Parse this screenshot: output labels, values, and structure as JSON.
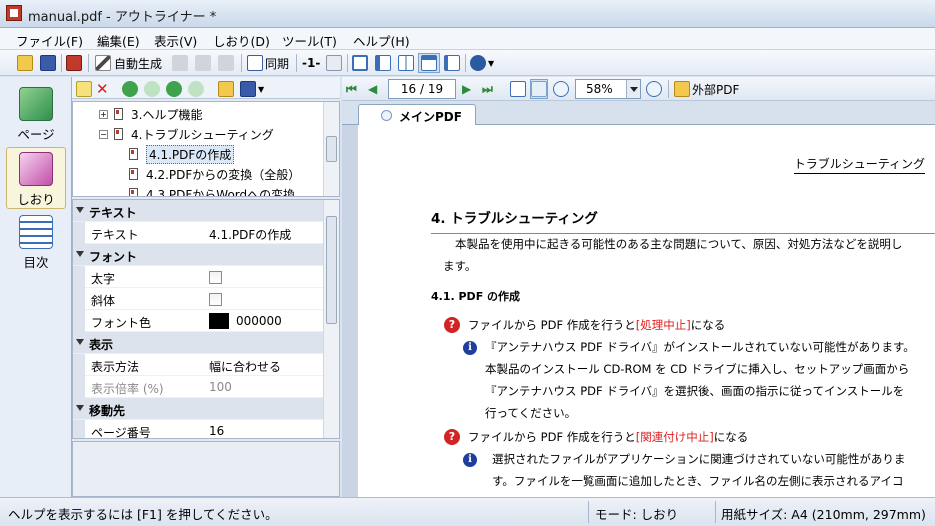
{
  "window": {
    "title": "manual.pdf - アウトライナー *"
  },
  "menu": [
    "ファイル(F)",
    "編集(E)",
    "表示(V)",
    "しおり(D)",
    "ツール(T)",
    "ヘルプ(H)"
  ],
  "toolbar": {
    "auto_generate": "自動生成",
    "sync": "同期",
    "one": "-1-"
  },
  "leftnav": [
    {
      "label": "ページ"
    },
    {
      "label": "しおり"
    },
    {
      "label": "目次"
    }
  ],
  "tree": {
    "items": [
      {
        "label": "3.ヘルプ機能",
        "expander": "+"
      },
      {
        "label": "4.トラブルシューティング",
        "expander": "−"
      },
      {
        "label": "4.1.PDFの作成"
      },
      {
        "label": "4.2.PDFからの変換（全般）"
      },
      {
        "label": "4.3.PDFからWordへの変換"
      }
    ]
  },
  "props": {
    "cat_text": "テキスト",
    "text_key": "テキスト",
    "text_val": "4.1.PDFの作成",
    "cat_font": "フォント",
    "bold_key": "太字",
    "italic_key": "斜体",
    "color_key": "フォント色",
    "color_val": "000000",
    "cat_display": "表示",
    "method_key": "表示方法",
    "method_val": "幅に合わせる",
    "zoom_key": "表示倍率 (%)",
    "zoom_val": "100",
    "cat_dest": "移動先",
    "page_key": "ページ番号",
    "page_val": "16"
  },
  "viewer": {
    "page_indicator": "16 / 19",
    "zoom": "58%",
    "external_pdf": "外部PDF",
    "tab": "メインPDF"
  },
  "document": {
    "running_header": "トラブルシューティング",
    "heading": "4.  トラブルシューティング",
    "intro_1": "本製品を使用中に起きる可能性のある主な問題について、原因、対処方法などを説明し",
    "intro_2": "ます。",
    "subheading": "4.1.  PDF の作成",
    "q1_pre": "ファイルから PDF 作成を行うと",
    "q1_red": "[処理中止]",
    "q1_post": "になる",
    "a1_1": "『アンテナハウス PDF ドライバ』がインストールされていない可能性があります。",
    "a1_2": "本製品のインストール CD-ROM を CD ドライブに挿入し、セットアップ画面から",
    "a1_3": "『アンテナハウス PDF ドライバ』を選択後、画面の指示に従ってインストールを",
    "a1_4": "行ってください。",
    "q2_pre": "ファイルから PDF 作成を行うと",
    "q2_red": "[関連付け中止]",
    "q2_post": "になる",
    "a2_1": "選択されたファイルがアプリケーションに関連づけされていない可能性がありま",
    "a2_2": "す。ファイルを一覧画面に追加したとき、ファイル名の左側に表示されるアイコ"
  },
  "status": {
    "help": "ヘルプを表示するには [F1] を押してください。",
    "mode": "モード: しおり",
    "paper": "用紙サイズ: A4 (210mm, 297mm)"
  },
  "colors": {
    "accent_red": "#d32424",
    "info_blue": "#1f3f9e",
    "selection": "#dbe8f8"
  }
}
